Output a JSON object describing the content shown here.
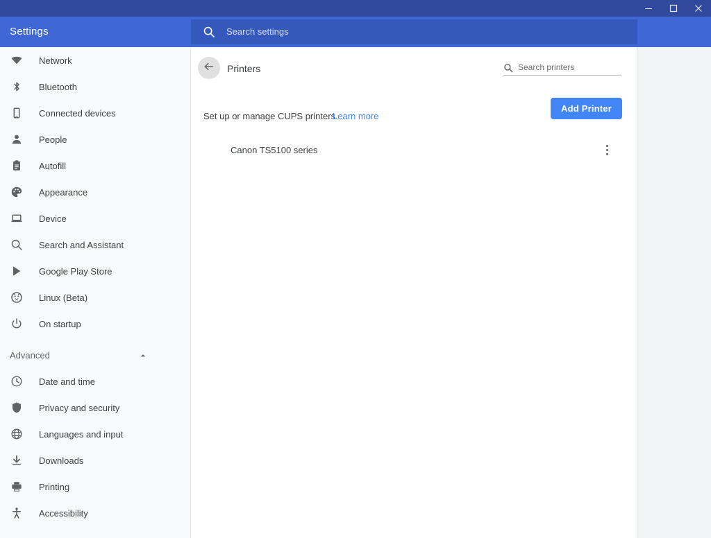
{
  "window": {
    "minimize_label": "Minimize",
    "maximize_label": "Maximize",
    "close_label": "Close"
  },
  "header": {
    "app_title": "Settings",
    "search_placeholder": "Search settings",
    "search_value": "",
    "search_icon": "search-icon",
    "background_color": "#3f68d4",
    "titlebar_color": "#31499b"
  },
  "sidebar": {
    "items": [
      {
        "label": "Network",
        "icon": "wifi-icon"
      },
      {
        "label": "Bluetooth",
        "icon": "bluetooth-icon"
      },
      {
        "label": "Connected devices",
        "icon": "phone-icon"
      },
      {
        "label": "People",
        "icon": "person-icon"
      },
      {
        "label": "Autofill",
        "icon": "clipboard-icon"
      },
      {
        "label": "Appearance",
        "icon": "palette-icon"
      },
      {
        "label": "Device",
        "icon": "laptop-icon"
      },
      {
        "label": "Search and Assistant",
        "icon": "search-icon"
      },
      {
        "label": "Google Play Store",
        "icon": "play-store-icon"
      },
      {
        "label": "Linux (Beta)",
        "icon": "penguin-icon"
      },
      {
        "label": "On startup",
        "icon": "power-icon"
      }
    ],
    "advanced": {
      "label": "Advanced",
      "chevron_icon": "chevron-up-icon",
      "expanded": true,
      "items": [
        {
          "label": "Date and time",
          "icon": "clock-icon"
        },
        {
          "label": "Privacy and security",
          "icon": "shield-icon"
        },
        {
          "label": "Languages and input",
          "icon": "globe-icon"
        },
        {
          "label": "Downloads",
          "icon": "download-icon"
        },
        {
          "label": "Printing",
          "icon": "printer-icon"
        },
        {
          "label": "Accessibility",
          "icon": "accessibility-icon"
        }
      ]
    }
  },
  "main": {
    "back_icon": "arrow-left-icon",
    "page_title": "Printers",
    "printer_search": {
      "icon": "search-icon",
      "placeholder": "Search printers",
      "value": ""
    },
    "cups": {
      "description": "Set up or manage CUPS printers.",
      "learn_more_label": "Learn more",
      "learn_more_color": "#4285f4"
    },
    "add_printer_label": "Add Printer",
    "add_printer_color": "#4285f4",
    "printers": [
      {
        "name": "Canon TS5100 series",
        "menu_icon": "more-vertical-icon"
      }
    ]
  }
}
